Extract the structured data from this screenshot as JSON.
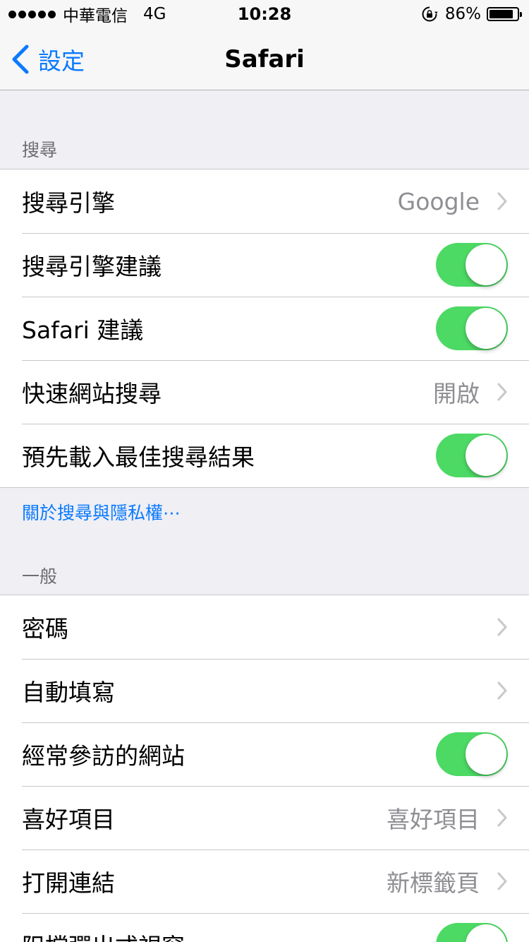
{
  "status_bar": {
    "carrier": "中華電信",
    "network": "4G",
    "time": "10:28",
    "battery_percent": "86%",
    "battery_level": 0.86,
    "icons": [
      "signal-dots-icon",
      "rotation-lock-icon",
      "battery-icon"
    ]
  },
  "nav": {
    "back_label": "設定",
    "title": "Safari"
  },
  "sections": {
    "search": {
      "header": "搜尋",
      "rows": [
        {
          "label": "搜尋引擎",
          "value": "Google"
        },
        {
          "label": "搜尋引擎建議",
          "toggle": true
        },
        {
          "label": "Safari 建議",
          "toggle": true
        },
        {
          "label": "快速網站搜尋",
          "value": "開啟"
        },
        {
          "label": "預先載入最佳搜尋結果",
          "toggle": true
        }
      ],
      "footer_link": "關於搜尋與隱私權⋯"
    },
    "general": {
      "header": "一般",
      "rows": [
        {
          "label": "密碼",
          "value": ""
        },
        {
          "label": "自動填寫",
          "value": ""
        },
        {
          "label": "經常參訪的網站",
          "toggle": true
        },
        {
          "label": "喜好項目",
          "value": "喜好項目"
        },
        {
          "label": "打開連結",
          "value": "新標籤頁"
        },
        {
          "label": "阻擋彈出式視窗",
          "toggle": true
        }
      ]
    }
  },
  "colors": {
    "accent": "#0a7aff",
    "toggle_on": "#4cd964",
    "background": "#efeff4",
    "secondary_text": "#8e8e93"
  }
}
